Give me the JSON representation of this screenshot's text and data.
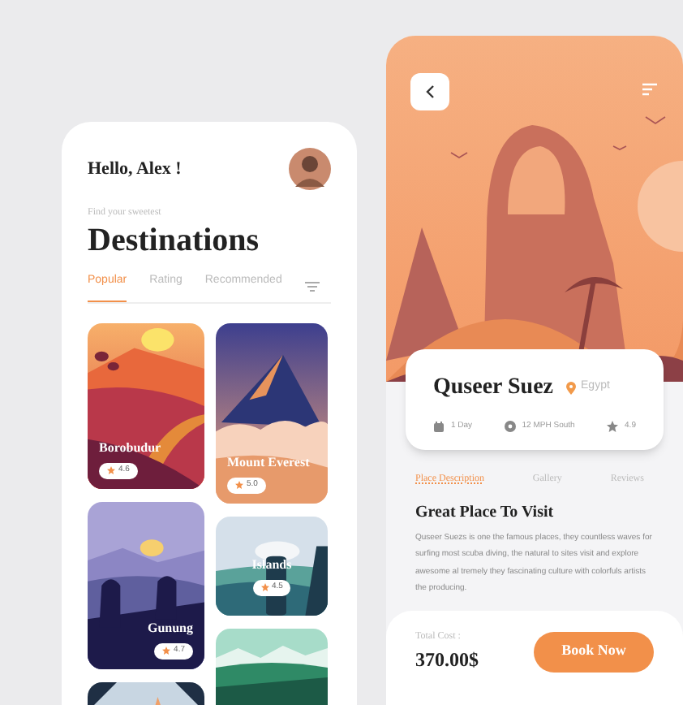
{
  "home": {
    "greeting": "Hello, Alex !",
    "subtitle": "Find your sweetest",
    "title": "Destinations",
    "tabs": [
      {
        "label": "Popular",
        "selected": true
      },
      {
        "label": "Rating",
        "selected": false
      },
      {
        "label": "Recommended",
        "selected": false
      }
    ],
    "columns": [
      [
        {
          "kind": "sunset",
          "name": "Borobudur",
          "rating": "4.6"
        },
        {
          "kind": "hikers",
          "name": "Gunung",
          "rating": "4.7"
        },
        {
          "kind": "tent"
        }
      ],
      [
        {
          "kind": "mountain",
          "name": "Mount Everest",
          "rating": "5.0"
        },
        {
          "kind": "islands",
          "name": "Islands",
          "rating": "4.5"
        },
        {
          "kind": "forest"
        }
      ]
    ]
  },
  "detail": {
    "title": "Quseer Suez",
    "location": "Egypt",
    "facts": [
      {
        "kind": "calendar",
        "text": "1 Day"
      },
      {
        "kind": "compass",
        "text": "12 MPH South"
      },
      {
        "kind": "star",
        "text": "4.9"
      }
    ],
    "tabs": [
      {
        "label": "Place Description",
        "selected": true
      },
      {
        "label": "Gallery",
        "selected": false
      },
      {
        "label": "Reviews",
        "selected": false
      }
    ],
    "heading": "Great Place To Visit",
    "description": "Quseer Suezs is one the famous  places, they countless waves for surfing most scuba diving, the natural to sites visit and explore awesome al tremely they fascinating culture with colorfuls artists the  producing.",
    "cost_label": "Total Cost :",
    "cost": "370.00$",
    "button": "Book Now"
  }
}
